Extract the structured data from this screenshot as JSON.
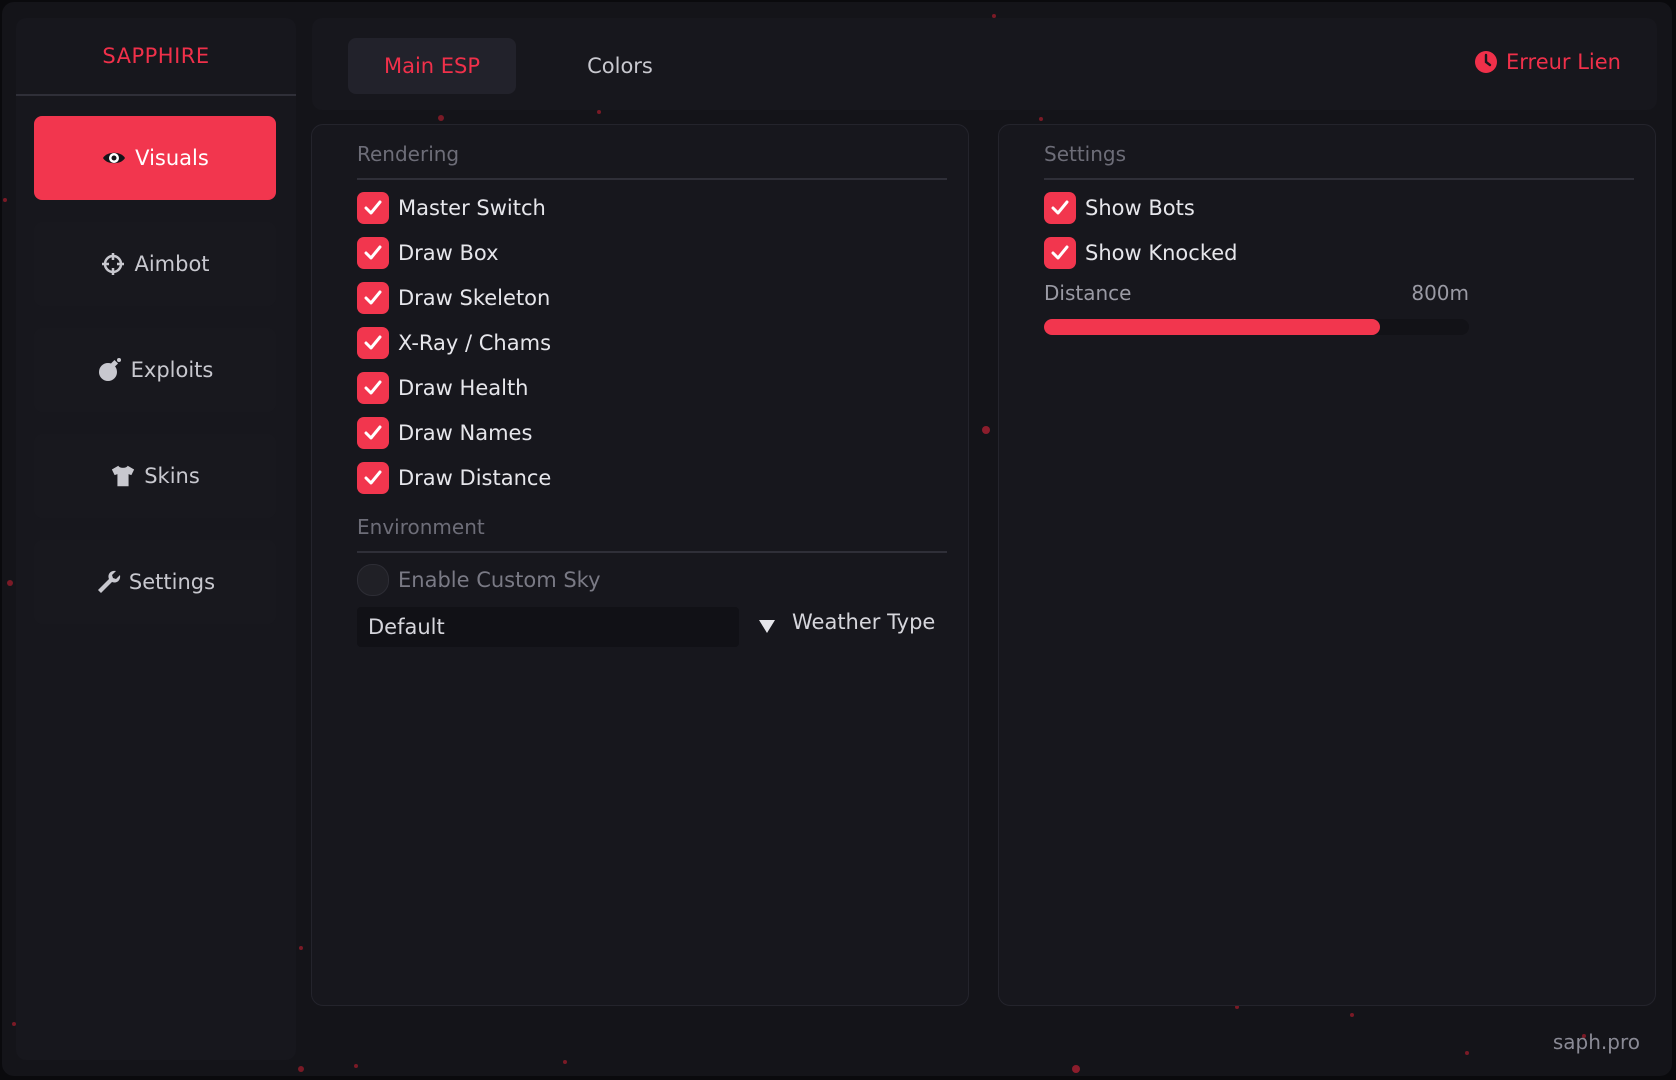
{
  "accent_color": "#f2364e",
  "sidebar": {
    "brand": "SAPPHIRE",
    "items": [
      {
        "label": "Visuals",
        "icon": "eye-icon",
        "active": true
      },
      {
        "label": "Aimbot",
        "icon": "crosshair-icon",
        "active": false
      },
      {
        "label": "Exploits",
        "icon": "bomb-icon",
        "active": false
      },
      {
        "label": "Skins",
        "icon": "shirt-icon",
        "active": false
      },
      {
        "label": "Settings",
        "icon": "wrench-icon",
        "active": false
      }
    ]
  },
  "header": {
    "tabs": [
      {
        "label": "Main ESP",
        "active": true
      },
      {
        "label": "Colors",
        "active": false
      }
    ],
    "status": {
      "label": "Erreur Lien",
      "icon": "clock-icon"
    }
  },
  "rendering": {
    "title": "Rendering",
    "options": [
      {
        "label": "Master Switch",
        "checked": true
      },
      {
        "label": "Draw Box",
        "checked": true
      },
      {
        "label": "Draw Skeleton",
        "checked": true
      },
      {
        "label": "X-Ray / Chams",
        "checked": true
      },
      {
        "label": "Draw Health",
        "checked": true
      },
      {
        "label": "Draw Names",
        "checked": true
      },
      {
        "label": "Draw Distance",
        "checked": true
      }
    ]
  },
  "environment": {
    "title": "Environment",
    "custom_sky": {
      "label": "Enable Custom Sky",
      "checked": false
    },
    "weather": {
      "selected": "Default",
      "label": "Weather Type"
    }
  },
  "settings_panel": {
    "title": "Settings",
    "options": [
      {
        "label": "Show Bots",
        "checked": true
      },
      {
        "label": "Show Knocked",
        "checked": true
      }
    ],
    "distance": {
      "label": "Distance",
      "value": "800m",
      "fraction": 0.79
    }
  },
  "footer": "saph.pro"
}
